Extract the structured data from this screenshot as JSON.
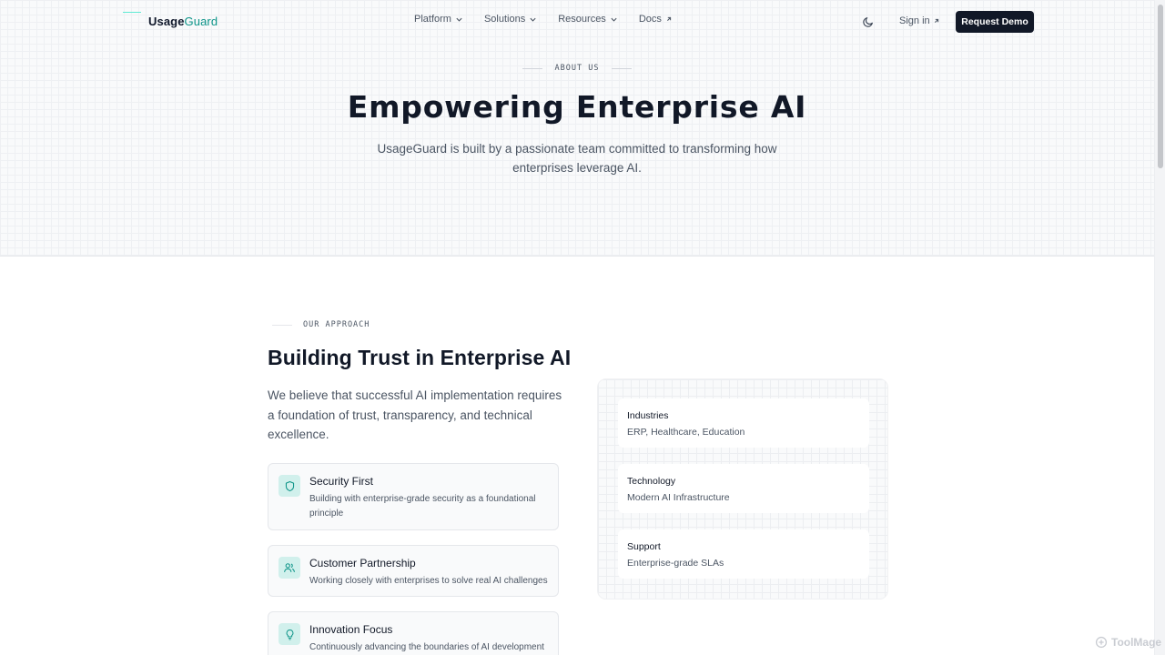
{
  "header": {
    "logo_bold": "Usage",
    "logo_accent": "Guard",
    "nav": [
      {
        "label": "Platform",
        "icon": "chevron-down-icon"
      },
      {
        "label": "Solutions",
        "icon": "chevron-down-icon"
      },
      {
        "label": "Resources",
        "icon": "chevron-down-icon"
      },
      {
        "label": "Docs",
        "icon": "external-link-icon"
      }
    ],
    "sign_in": "Sign in",
    "request_demo": "Request Demo"
  },
  "hero": {
    "eyebrow": "ABOUT US",
    "title": "Empowering Enterprise AI",
    "subtitle": "UsageGuard is built by a passionate team committed to transforming how enterprises leverage AI."
  },
  "approach": {
    "eyebrow": "OUR APPROACH",
    "title": "Building Trust in Enterprise AI",
    "lead": "We believe that successful AI implementation requires a foundation of trust, transparency, and technical excellence.",
    "features": [
      {
        "title": "Security First",
        "desc": "Building with enterprise-grade security as a foundational principle",
        "icon": "shield-icon"
      },
      {
        "title": "Customer Partnership",
        "desc": "Working closely with enterprises to solve real AI challenges",
        "icon": "users-icon"
      },
      {
        "title": "Innovation Focus",
        "desc": "Continuously advancing the boundaries of AI development",
        "icon": "lightbulb-icon"
      }
    ]
  },
  "info": [
    {
      "label": "Industries",
      "value": "ERP, Healthcare, Education"
    },
    {
      "label": "Technology",
      "value": "Modern AI Infrastructure"
    },
    {
      "label": "Support",
      "value": "Enterprise-grade SLAs"
    }
  ],
  "watermark": "ToolMage",
  "colors": {
    "accent": "#0d9488",
    "accent_soft": "#d1f0ec",
    "dark_button": "#111827",
    "text_muted": "#4b5563"
  }
}
